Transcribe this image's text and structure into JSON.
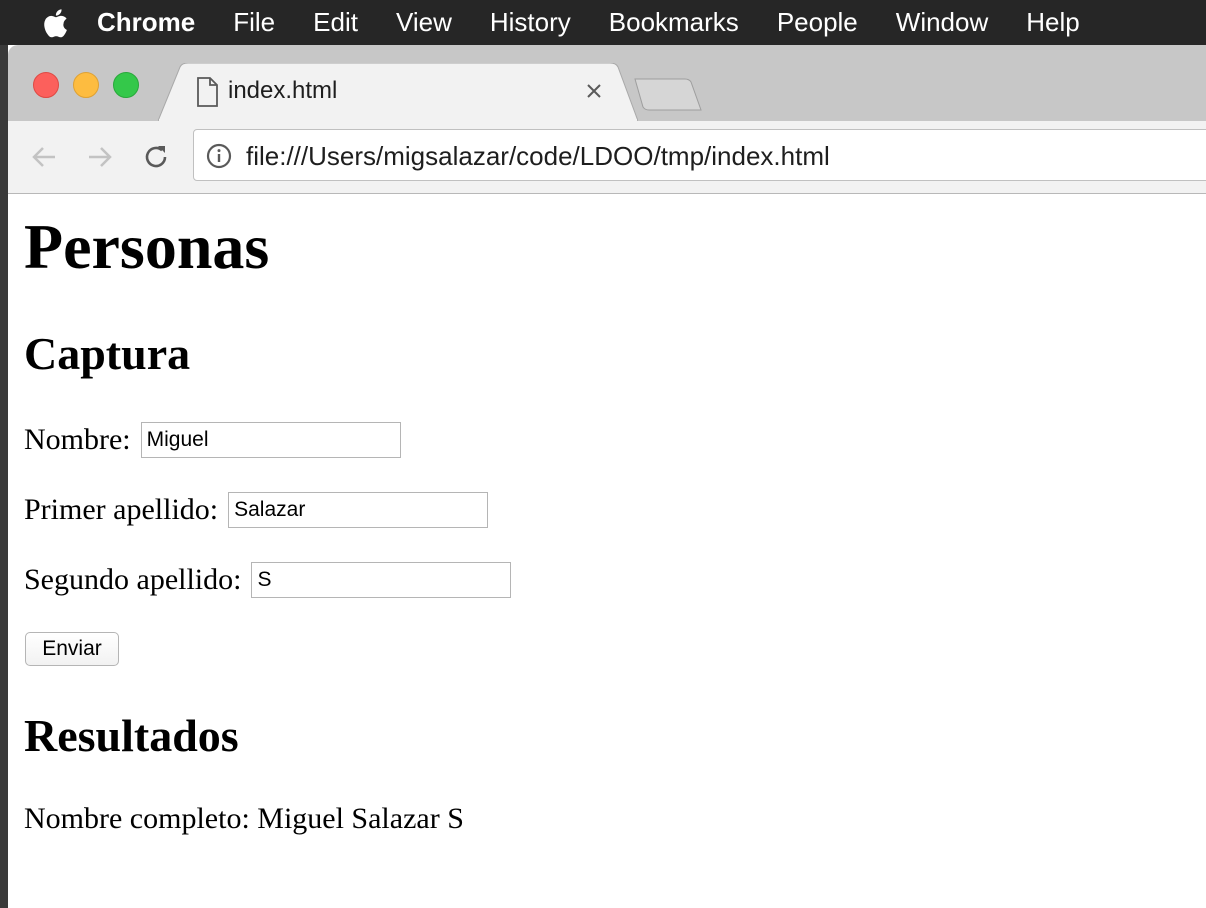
{
  "menubar": {
    "app_name": "Chrome",
    "items": [
      "File",
      "Edit",
      "View",
      "History",
      "Bookmarks",
      "People",
      "Window",
      "Help"
    ]
  },
  "browser": {
    "tab": {
      "title": "index.html",
      "icon": "file-icon"
    },
    "url": "file:///Users/migsalazar/code/LDOO/tmp/index.html"
  },
  "page": {
    "title": "Personas",
    "capture_heading": "Captura",
    "fields": [
      {
        "label": "Nombre:",
        "value": "Miguel"
      },
      {
        "label": "Primer apellido:",
        "value": "Salazar"
      },
      {
        "label": "Segundo apellido:",
        "value": "S"
      }
    ],
    "submit_label": "Enviar",
    "results_heading": "Resultados",
    "result_text": "Nombre completo: Miguel Salazar S"
  },
  "colors": {
    "menubar_bg": "#262626",
    "tabbar_bg": "#c7c7c7",
    "toolbar_bg": "#f2f2f2",
    "close_red": "#fc605c",
    "minimize_yellow": "#fdbc40",
    "zoom_green": "#34c84a"
  }
}
